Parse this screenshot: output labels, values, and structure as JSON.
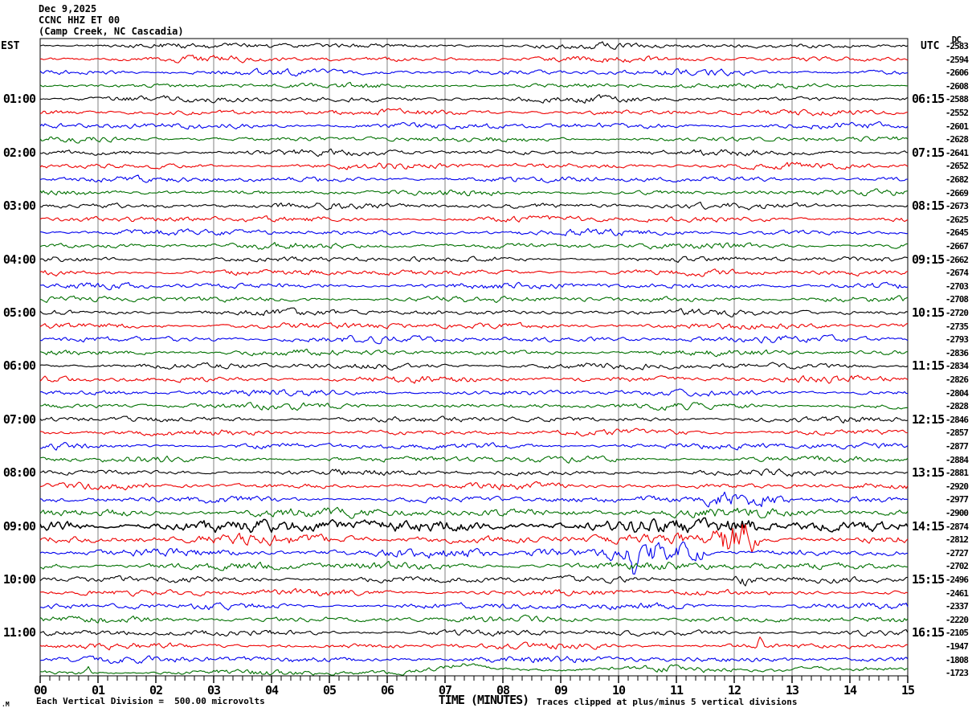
{
  "title": {
    "date": "Dec 9,2025",
    "station": "CCNC HHZ ET 00",
    "location": "(Camp Creek, NC Cascadia)"
  },
  "left_axis": {
    "header": "EST"
  },
  "right_axis": {
    "header": "UTC",
    "dc_header": "DC"
  },
  "x_axis": {
    "title": "TIME (MINUTES)"
  },
  "footer": {
    "left": "Each Vertical Division =  500.00 microvolts",
    "right": "Traces clipped at plus/minus 5 vertical divisions",
    "corner": ".M"
  },
  "colors": {
    "trace_cycle": [
      "#000000",
      "#ee0000",
      "#0000ee",
      "#007000"
    ],
    "grid": "#808080",
    "axis": "#000000",
    "background": "#ffffff"
  },
  "chart_data": {
    "type": "line",
    "subtype": "seismogram-helicorder",
    "title": "CCNC HHZ ET 00 (Camp Creek, NC Cascadia) Dec 9,2025",
    "xlabel": "TIME (MINUTES)",
    "x_range_minutes": [
      0,
      15
    ],
    "x_tick_labels": [
      "00",
      "01",
      "02",
      "03",
      "04",
      "05",
      "06",
      "07",
      "08",
      "09",
      "10",
      "11",
      "12",
      "13",
      "14",
      "15"
    ],
    "x_minor_subdivisions": 6,
    "minutes_per_line": 15,
    "lines_per_hour": 4,
    "trace_count": 48,
    "scale_note": "Each Vertical Division =  500.00 microvolts",
    "clip_note": "Traces clipped at plus/minus 5 vertical divisions",
    "left_time_labels": [
      {
        "row": 4,
        "text": "01:00"
      },
      {
        "row": 8,
        "text": "02:00"
      },
      {
        "row": 12,
        "text": "03:00"
      },
      {
        "row": 16,
        "text": "04:00"
      },
      {
        "row": 20,
        "text": "05:00"
      },
      {
        "row": 24,
        "text": "06:00"
      },
      {
        "row": 28,
        "text": "07:00"
      },
      {
        "row": 32,
        "text": "08:00"
      },
      {
        "row": 36,
        "text": "09:00"
      },
      {
        "row": 40,
        "text": "10:00"
      },
      {
        "row": 44,
        "text": "11:00"
      }
    ],
    "right_time_labels": [
      {
        "row": 4,
        "text": "06:15"
      },
      {
        "row": 8,
        "text": "07:15"
      },
      {
        "row": 12,
        "text": "08:15"
      },
      {
        "row": 16,
        "text": "09:15"
      },
      {
        "row": 20,
        "text": "10:15"
      },
      {
        "row": 24,
        "text": "11:15"
      },
      {
        "row": 28,
        "text": "12:15"
      },
      {
        "row": 32,
        "text": "13:15"
      },
      {
        "row": 36,
        "text": "14:15"
      },
      {
        "row": 40,
        "text": "15:15"
      },
      {
        "row": 44,
        "text": "16:15"
      }
    ],
    "dc_values": [
      "-2583",
      "-2594",
      "-2606",
      "-2608",
      "-2588",
      "-2552",
      "-2601",
      "-2628",
      "-2641",
      "-2652",
      "-2682",
      "-2669",
      "-2673",
      "-2625",
      "-2645",
      "-2667",
      "-2662",
      "-2674",
      "-2703",
      "-2708",
      "-2720",
      "-2735",
      "-2793",
      "-2836",
      "-2834",
      "-2826",
      "-2804",
      "-2828",
      "-2846",
      "-2857",
      "-2877",
      "-2884",
      "-2881",
      "-2920",
      "-2977",
      "-2900",
      "-2874",
      "-2812",
      "-2727",
      "-2702",
      "-2496",
      "-2461",
      "-2337",
      "-2220",
      "-2105",
      "-1947",
      "-1808",
      "-1723"
    ],
    "amps": [
      2.2,
      2.3,
      2.3,
      2.1,
      2.3,
      2.3,
      2.4,
      2.1,
      2.3,
      2.3,
      2.3,
      2.2,
      2.4,
      2.3,
      2.4,
      2.3,
      2.2,
      2.4,
      2.4,
      2.3,
      2.4,
      2.4,
      2.6,
      2.4,
      2.4,
      2.5,
      2.4,
      2.4,
      2.3,
      2.4,
      2.4,
      2.4,
      2.3,
      2.4,
      2.4,
      3.6,
      5.2,
      3.8,
      2.8,
      3.2,
      2.6,
      2.6,
      2.6,
      2.4,
      2.4,
      2.3,
      2.6,
      2.1
    ],
    "events": {
      "34": [
        {
          "type": "burst",
          "start": 11.3,
          "end": 12.95,
          "amp": 7
        }
      ],
      "35": [
        {
          "type": "burst",
          "start": 11.3,
          "end": 12.9,
          "amp": 5
        }
      ],
      "36": [
        {
          "type": "burst",
          "start": 11.5,
          "end": 12.5,
          "amp": 7.5
        }
      ],
      "37": [
        {
          "type": "burst",
          "start": 11.62,
          "end": 12.42,
          "amp": 18
        }
      ],
      "38": [
        {
          "type": "burst",
          "start": 5.6,
          "end": 8.0,
          "amp": 5
        },
        {
          "type": "burst",
          "start": 9.7,
          "end": 11.6,
          "amp": 10
        },
        {
          "type": "spike",
          "at": 10.28,
          "amp": 26,
          "dir": 1
        }
      ],
      "40": [
        {
          "type": "burst",
          "start": 11.95,
          "end": 12.4,
          "amp": 6
        }
      ],
      "45": [
        {
          "type": "spike",
          "at": 12.45,
          "amp": 12,
          "dir": -1
        }
      ],
      "47": [
        {
          "type": "spike",
          "at": 0.83,
          "amp": 7,
          "dir": -1
        }
      ]
    },
    "drift": {
      "47": [
        [
          0,
          0
        ],
        [
          6.3,
          0
        ],
        [
          6.8,
          -5
        ],
        [
          7.35,
          -11
        ],
        [
          7.8,
          -7
        ],
        [
          8.3,
          -4
        ],
        [
          9.2,
          -3
        ],
        [
          10.1,
          -5
        ],
        [
          10.9,
          -6
        ],
        [
          11.5,
          -3
        ],
        [
          12.2,
          -4
        ],
        [
          12.8,
          -2
        ],
        [
          13.2,
          -6
        ],
        [
          14.0,
          -4
        ],
        [
          14.6,
          -5
        ],
        [
          15,
          -4
        ]
      ]
    }
  }
}
